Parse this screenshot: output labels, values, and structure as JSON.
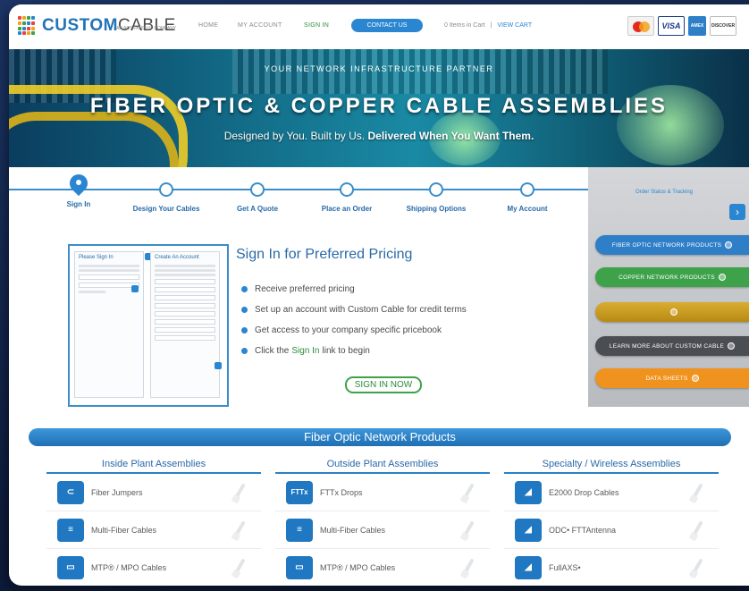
{
  "header": {
    "logo_brand": "CUSTOM",
    "logo_brand2": "CABLE",
    "logo_sub": "AN ACT PANDUIT COMPANY",
    "nav": [
      "HOME",
      "MY ACCOUNT",
      "SIGN IN"
    ],
    "contact_label": "CONTACT US",
    "cart_count": "0 Items in Cart",
    "cart_sep": "|",
    "view_cart": "VIEW CART",
    "cards": [
      "mastercard",
      "VISA",
      "AMEX",
      "DISCOVER"
    ]
  },
  "hero": {
    "kicker": "YOUR NETWORK INFRASTRUCTURE PARTNER",
    "title": "FIBER OPTIC & COPPER CABLE ASSEMBLIES",
    "subtitle_start": "Designed by You. Built by Us.",
    "subtitle_bold": "Delivered When You Want Them."
  },
  "steps": [
    {
      "label": "Sign In"
    },
    {
      "label": "Design Your Cables"
    },
    {
      "label": "Get A Quote"
    },
    {
      "label": "Place an Order"
    },
    {
      "label": "Shipping Options"
    },
    {
      "label": "My Account"
    }
  ],
  "preview": {
    "left_title": "Please Sign In",
    "right_title": "Create An Account"
  },
  "pricing": {
    "title": "Sign In for Preferred Pricing",
    "bullets": [
      "Receive preferred pricing",
      "Set up an account with Custom Cable for credit terms",
      "Get access to your company specific pricebook"
    ],
    "last_bullet_pre": "Click the",
    "last_bullet_link": "Sign In",
    "last_bullet_post": "link to begin",
    "button": "SIGN IN NOW"
  },
  "sidebar": {
    "order_tracking": "Order Status & Tracking",
    "arrow": "›",
    "buttons": [
      {
        "label": "FIBER OPTIC NETWORK PRODUCTS",
        "color": "#2f7fc8"
      },
      {
        "label": "COPPER NETWORK PRODUCTS",
        "color": "#3ea24a"
      },
      {
        "label": "",
        "color": "#c79a22"
      },
      {
        "label": "LEARN MORE ABOUT CUSTOM CABLE",
        "color": "#4a4d52"
      },
      {
        "label": "DATA SHEETS",
        "color": "#f0931e"
      }
    ]
  },
  "products": {
    "section_title": "Fiber Optic Network Products",
    "categories": [
      {
        "title": "Inside Plant Assemblies",
        "items": [
          {
            "name": "Fiber Jumpers",
            "icon": "fiber-jumper-icon",
            "glyph": "⊂"
          },
          {
            "name": "Multi-Fiber Cables",
            "icon": "multi-fiber-icon",
            "glyph": "≡"
          },
          {
            "name": "MTP® / MPO Cables",
            "icon": "mtp-connector-icon",
            "glyph": "▭"
          }
        ]
      },
      {
        "title": "Outside Plant Assemblies",
        "items": [
          {
            "name": "FTTx Drops",
            "icon": "fttx-icon",
            "glyph": "FTTx"
          },
          {
            "name": "Multi-Fiber Cables",
            "icon": "multi-fiber-icon",
            "glyph": "≡"
          },
          {
            "name": "MTP® / MPO Cables",
            "icon": "mtp-connector-icon",
            "glyph": "▭"
          }
        ]
      },
      {
        "title": "Specialty / Wireless Assemblies",
        "items": [
          {
            "name": "E2000 Drop Cables",
            "icon": "e2000-connector-icon",
            "glyph": "◢"
          },
          {
            "name": "ODC• FTTAntenna",
            "icon": "odc-antenna-icon",
            "glyph": "◢"
          },
          {
            "name": "FullAXS•",
            "icon": "fullaxs-icon",
            "glyph": "◢"
          }
        ]
      }
    ]
  }
}
